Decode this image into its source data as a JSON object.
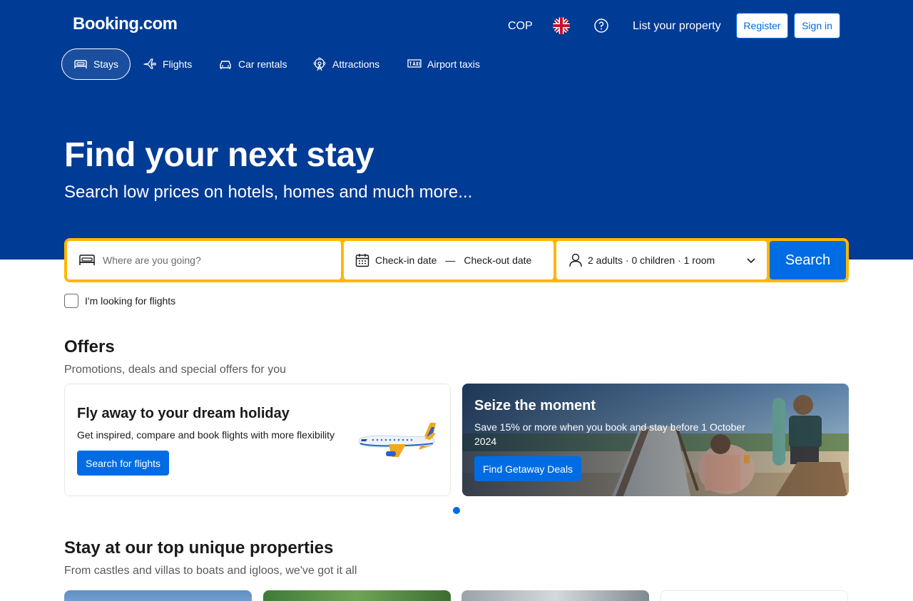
{
  "header": {
    "logo": "Booking.com",
    "currency": "COP",
    "list_property": "List your property",
    "register": "Register",
    "sign_in": "Sign in"
  },
  "nav": {
    "tabs": [
      {
        "label": "Stays",
        "icon": "bed-icon",
        "active": true
      },
      {
        "label": "Flights",
        "icon": "plane-icon",
        "active": false
      },
      {
        "label": "Car rentals",
        "icon": "car-icon",
        "active": false
      },
      {
        "label": "Attractions",
        "icon": "attractions-icon",
        "active": false
      },
      {
        "label": "Airport taxis",
        "icon": "taxi-icon",
        "active": false
      }
    ]
  },
  "hero": {
    "title": "Find your next stay",
    "subtitle": "Search low prices on hotels, homes and much more..."
  },
  "search": {
    "destination_placeholder": "Where are you going?",
    "checkin": "Check-in date",
    "date_separator": "—",
    "checkout": "Check-out date",
    "guests": "2 adults · 0 children · 1 room",
    "button": "Search",
    "flights_checkbox": "I'm looking for flights"
  },
  "offers": {
    "title": "Offers",
    "subtitle": "Promotions, deals and special offers for you",
    "cards": [
      {
        "title": "Fly away to your dream holiday",
        "text": "Get inspired, compare and book flights with more flexibility",
        "button": "Search for flights"
      },
      {
        "title": "Seize the moment",
        "text": "Save 15% or more when you book and stay before 1 October 2024",
        "button": "Find Getaway Deals"
      }
    ]
  },
  "unique": {
    "title": "Stay at our top unique properties",
    "subtitle": "From castles and villas to boats and igloos, we've got it all"
  },
  "colors": {
    "brand_blue": "#003b95",
    "action_blue": "#006ce4",
    "search_yellow": "#ffb700"
  }
}
